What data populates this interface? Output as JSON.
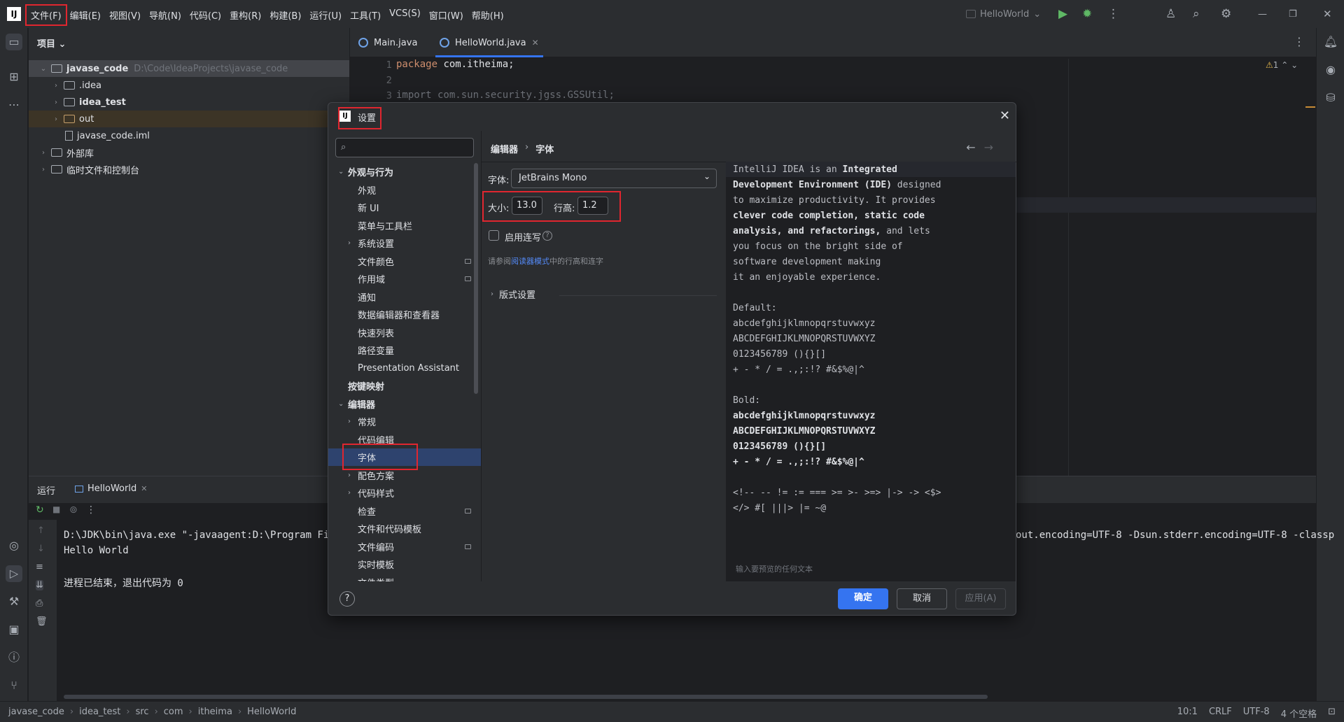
{
  "app": {
    "logo": "IJ",
    "menu": [
      "文件(F)",
      "编辑(E)",
      "视图(V)",
      "导航(N)",
      "代码(C)",
      "重构(R)",
      "构建(B)",
      "运行(U)",
      "工具(T)",
      "VCS(S)",
      "窗口(W)",
      "帮助(H)"
    ],
    "run_config": "HelloWorld"
  },
  "project": {
    "header": "项目",
    "tree": [
      {
        "name": "javase_code",
        "path": "D:\\Code\\IdeaProjects\\javase_code"
      },
      {
        "name": ".idea"
      },
      {
        "name": "idea_test"
      },
      {
        "name": "out"
      },
      {
        "name": "javase_code.iml"
      },
      {
        "name": "外部库"
      },
      {
        "name": "临时文件和控制台"
      }
    ]
  },
  "editor": {
    "tabs": [
      "Main.java",
      "HelloWorld.java"
    ],
    "lines": [
      {
        "num": "1",
        "kw": "package",
        "text": " com.itheima;"
      },
      {
        "num": "2",
        "kw": "",
        "text": ""
      },
      {
        "num": "3",
        "kw": "import",
        "text": " com.sun.security.jgss.GSSUtil;"
      }
    ],
    "warning_count": "1"
  },
  "run": {
    "title": "运行",
    "tab": "HelloWorld",
    "output": [
      "D:\\JDK\\bin\\java.exe \"-javaagent:D:\\Program Files",
      "Hello World",
      "",
      "进程已结束，退出代码为 0"
    ],
    "output_right": "out.encoding=UTF-8 -Dsun.stderr.encoding=UTF-8 -classp"
  },
  "statusbar": {
    "crumbs": [
      "javase_code",
      "idea_test",
      "src",
      "com",
      "itheima",
      "HelloWorld"
    ],
    "position": "10:1",
    "line_sep": "CRLF",
    "encoding": "UTF-8",
    "indent": "4 个空格"
  },
  "dialog": {
    "title": "设置",
    "search_placeholder": "",
    "tree": [
      {
        "label": "外观与行为",
        "level": 0,
        "expanded": true,
        "bold": true
      },
      {
        "label": "外观",
        "level": 1
      },
      {
        "label": "新 UI",
        "level": 1
      },
      {
        "label": "菜单与工具栏",
        "level": 1
      },
      {
        "label": "系统设置",
        "level": 1,
        "collapsed": true
      },
      {
        "label": "文件颜色",
        "level": 1,
        "mod": true
      },
      {
        "label": "作用域",
        "level": 1,
        "mod": true
      },
      {
        "label": "通知",
        "level": 1
      },
      {
        "label": "数据编辑器和查看器",
        "level": 1
      },
      {
        "label": "快速列表",
        "level": 1
      },
      {
        "label": "路径变量",
        "level": 1
      },
      {
        "label": "Presentation Assistant",
        "level": 1
      },
      {
        "label": "按键映射",
        "level": 0,
        "bold": true
      },
      {
        "label": "编辑器",
        "level": 0,
        "expanded": true,
        "bold": true
      },
      {
        "label": "常规",
        "level": 1,
        "collapsed": true
      },
      {
        "label": "代码编辑",
        "level": 1
      },
      {
        "label": "字体",
        "level": 1,
        "selected": true
      },
      {
        "label": "配色方案",
        "level": 1,
        "collapsed": true
      },
      {
        "label": "代码样式",
        "level": 1,
        "collapsed": true
      },
      {
        "label": "检查",
        "level": 1,
        "mod": true
      },
      {
        "label": "文件和代码模板",
        "level": 1
      },
      {
        "label": "文件编码",
        "level": 1,
        "mod": true
      },
      {
        "label": "实时模板",
        "level": 1
      },
      {
        "label": "文件类型",
        "level": 1
      }
    ],
    "breadcrumb": [
      "编辑器",
      "字体"
    ],
    "font_label": "字体:",
    "font_value": "JetBrains Mono",
    "size_label": "大小:",
    "size_value": "13.0",
    "lineheight_label": "行高:",
    "lineheight_value": "1.2",
    "ligatures_label": "启用连写",
    "hint_prefix": "请参阅",
    "hint_link": "阅读器模式",
    "hint_suffix": "中的行高和连字",
    "section": "版式设置",
    "preview": [
      [
        {
          "t": "IntelliJ IDEA is an "
        },
        {
          "t": "Integrated",
          "b": true
        }
      ],
      [
        {
          "t": "Development Environment (IDE)",
          "b": true
        },
        {
          "t": " designed"
        }
      ],
      [
        {
          "t": "to maximize productivity. It provides"
        }
      ],
      [
        {
          "t": "clever code completion, static code",
          "b": true
        }
      ],
      [
        {
          "t": "analysis, and refactorings,",
          "b": true
        },
        {
          "t": " and lets"
        }
      ],
      [
        {
          "t": "you focus on the bright side of"
        }
      ],
      [
        {
          "t": "software development making"
        }
      ],
      [
        {
          "t": "it an enjoyable experience."
        }
      ],
      [
        {
          "t": ""
        }
      ],
      [
        {
          "t": "Default:"
        }
      ],
      [
        {
          "t": "abcdefghijklmnopqrstuvwxyz"
        }
      ],
      [
        {
          "t": "ABCDEFGHIJKLMNOPQRSTUVWXYZ"
        }
      ],
      [
        {
          "t": "0123456789 (){}[]"
        }
      ],
      [
        {
          "t": "+ - * / = .,;:!? #&$%@|^"
        }
      ],
      [
        {
          "t": ""
        }
      ],
      [
        {
          "t": "Bold:"
        }
      ],
      [
        {
          "t": "abcdefghijklmnopqrstuvwxyz",
          "b": true
        }
      ],
      [
        {
          "t": "ABCDEFGHIJKLMNOPQRSTUVWXYZ",
          "b": true
        }
      ],
      [
        {
          "t": "0123456789 (){}[]",
          "b": true
        }
      ],
      [
        {
          "t": "+ - * / = .,;:!? #&$%@|^",
          "b": true
        }
      ],
      [
        {
          "t": ""
        }
      ],
      [
        {
          "t": "<!-- -- != := === >= >- >=> |-> -> <$>"
        }
      ],
      [
        {
          "t": "</> #[ |||> |= ~@"
        }
      ]
    ],
    "preview_hint": "输入要预览的任何文本",
    "ok": "确定",
    "cancel": "取消",
    "apply": "应用(A)",
    "help": "?"
  }
}
